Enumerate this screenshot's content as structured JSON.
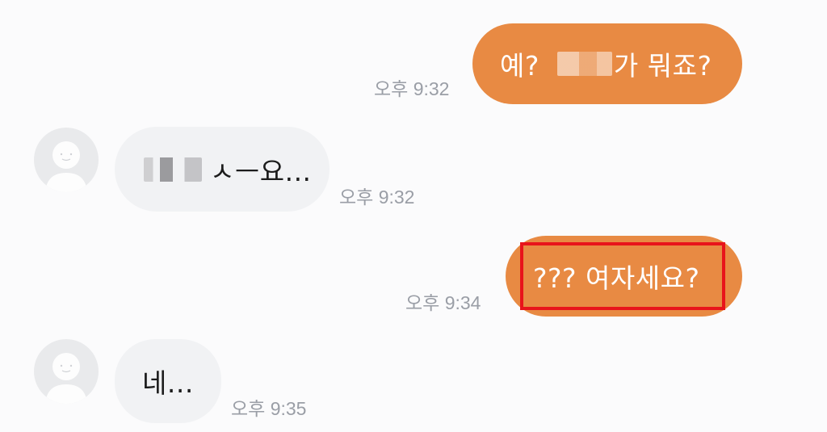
{
  "messages": [
    {
      "direction": "outgoing",
      "text_before": "예?",
      "redacted": true,
      "text_after": "가 뭐죠?",
      "time": "오후 9:32"
    },
    {
      "direction": "incoming",
      "redacted": true,
      "text_after": "ㅅㅡ요...",
      "time": "오후 9:32"
    },
    {
      "direction": "outgoing",
      "text": "??? 여자세요?",
      "time": "오후 9:34",
      "highlighted": true
    },
    {
      "direction": "incoming",
      "text": "네...",
      "time": "오후 9:35"
    }
  ],
  "colors": {
    "outgoing_bubble": "#e88a43",
    "incoming_bubble": "#f1f2f4",
    "highlight": "#e8141b",
    "timestamp": "#9a9ea6"
  },
  "icons": {
    "avatar": "default-profile-avatar-icon"
  }
}
